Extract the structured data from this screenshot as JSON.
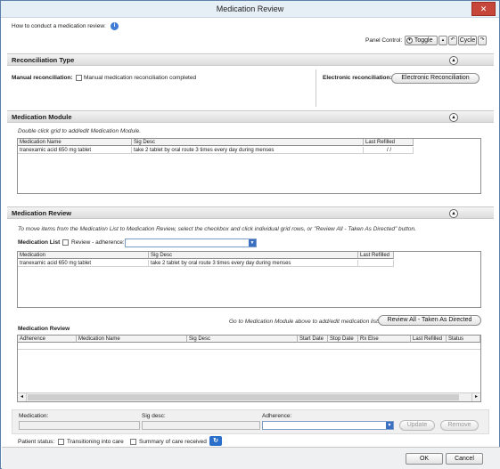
{
  "window": {
    "title": "Medication Review",
    "close_glyph": "✕"
  },
  "help": {
    "text": "How to conduct a medication review:",
    "icon": "info-icon"
  },
  "panel_control": {
    "label": "Panel Control:",
    "toggle": "Toggle",
    "cycle": "Cycle"
  },
  "reconciliation": {
    "header": "Reconciliation Type",
    "manual_label": "Manual reconciliation:",
    "manual_checkbox": "Manual medication reconciliation completed",
    "electronic_label": "Electronic reconciliation:",
    "electronic_button": "Electronic Reconciliation"
  },
  "module": {
    "header": "Medication Module",
    "hint": "Double click grid to add/edit Medication Module.",
    "columns": [
      "Medication Name",
      "Sig Desc",
      "Last Refilled"
    ],
    "rows": [
      [
        "tranexamic acid 650 mg tablet",
        "take 2 tablet by oral route 3 times every day during menses",
        " /  /"
      ]
    ]
  },
  "review": {
    "header": "Medication Review",
    "instructions": "To move items from the Medication List to Medication Review, select the checkbox and click individual grid rows, or \"Review All - Taken As Directed\" button.",
    "list_label": "Medication List",
    "adherence_checkbox": "Review - adherence:",
    "list_columns": [
      "Medication",
      "Sig Desc",
      "Last Refilled"
    ],
    "list_rows": [
      [
        "tranexamic acid 650 mg tablet",
        "take 2 tablet by oral route 3 times every day during menses",
        ""
      ]
    ],
    "goto_hint": "Go to Medication Module above to add/edit medication list.",
    "review_all_button": "Review All - Taken As Directed",
    "review_grid_label": "Medication Review",
    "review_columns": [
      "Adherence",
      "Medication Name",
      "Sig Desc",
      "Start Date",
      "Stop Date",
      "Rx Else",
      "Last Refilled",
      "Status"
    ]
  },
  "editor": {
    "medication_label": "Medication:",
    "sig_label": "Sig desc:",
    "adherence_label": "Adherence:",
    "update_button": "Update",
    "remove_button": "Remove"
  },
  "patient_status": {
    "label": "Patient status:",
    "transitioning": "Transitioning into care",
    "summary": "Summary of care received"
  },
  "footer": {
    "ok": "OK",
    "cancel": "Cancel"
  }
}
